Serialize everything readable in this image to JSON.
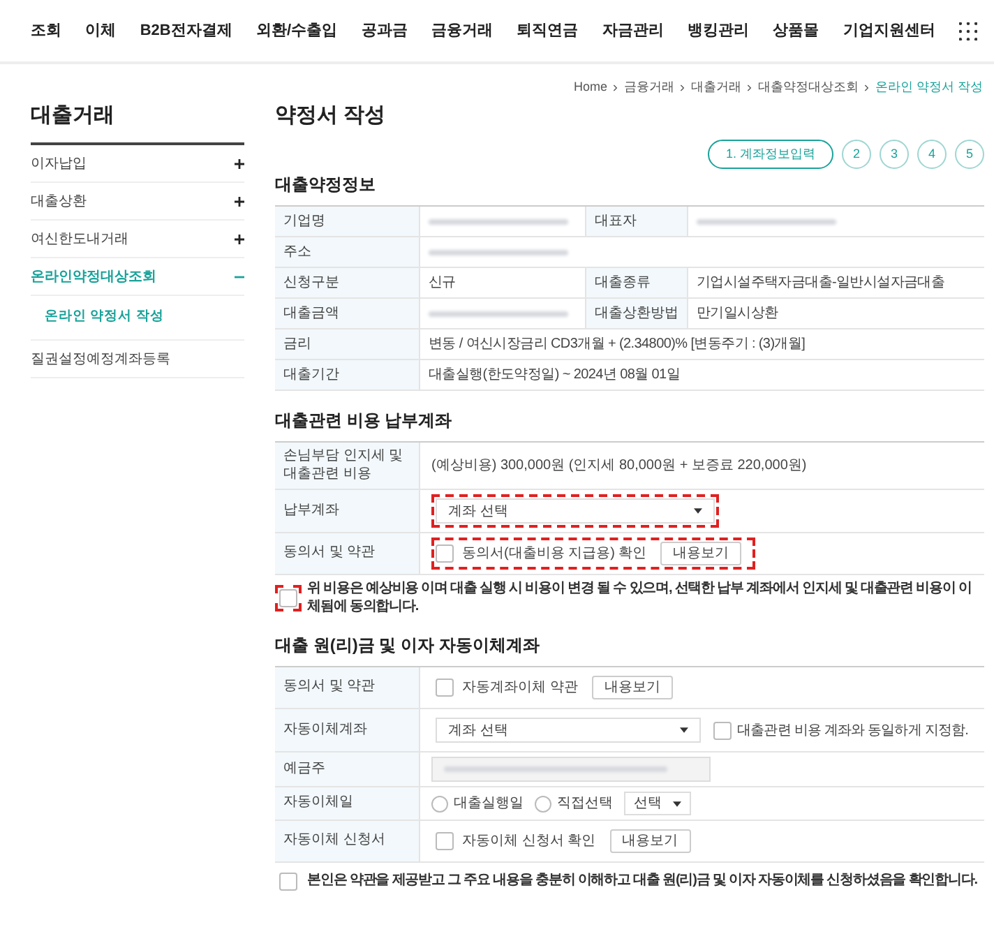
{
  "nav": {
    "items": [
      "조회",
      "이체",
      "B2B전자결제",
      "외환/수출입",
      "공과금",
      "금융거래",
      "퇴직연금",
      "자금관리",
      "뱅킹관리",
      "상품몰",
      "기업지원센터"
    ]
  },
  "breadcrumb": [
    {
      "label": "Home",
      "current": false
    },
    {
      "label": "금융거래",
      "current": false
    },
    {
      "label": "대출거래",
      "current": false
    },
    {
      "label": "대출약정대상조회",
      "current": false
    },
    {
      "label": "온라인 약정서 작성",
      "current": true
    }
  ],
  "sidebar": {
    "title": "대출거래",
    "items": [
      {
        "label": "이자납입",
        "expandable": true,
        "expanded": false,
        "selected": false
      },
      {
        "label": "대출상환",
        "expandable": true,
        "expanded": false,
        "selected": false
      },
      {
        "label": "여신한도내거래",
        "expandable": true,
        "expanded": false,
        "selected": false
      },
      {
        "label": "온라인약정대상조회",
        "expandable": true,
        "expanded": true,
        "selected": true,
        "children": [
          {
            "label": "온라인 약정서 작성",
            "selected": true
          }
        ]
      },
      {
        "label": "질권설정예정계좌등록",
        "selected": false
      }
    ]
  },
  "page_title": "약정서 작성",
  "steps": [
    {
      "label": "1. 계좌정보입력",
      "selected": true
    },
    {
      "label": "2",
      "selected": false
    },
    {
      "label": "3",
      "selected": false
    },
    {
      "label": "4",
      "selected": false
    },
    {
      "label": "5",
      "selected": false
    }
  ],
  "loan_info": {
    "title": "대출약정정보",
    "rows": [
      [
        {
          "label": "기업명",
          "kind": "redacted"
        },
        {
          "label": "대표자",
          "kind": "redacted"
        }
      ],
      [
        {
          "label": "주소",
          "kind": "redacted"
        }
      ],
      [
        {
          "label": "신청구분",
          "kind": "text",
          "value": "신규"
        },
        {
          "label": "대출종류",
          "kind": "text",
          "value": "기업시설주택자금대출-일반시설자금대출"
        }
      ],
      [
        {
          "label": "대출금액",
          "kind": "redacted"
        },
        {
          "label": "대출상환방법",
          "kind": "text",
          "value": "만기일시상환"
        }
      ],
      [
        {
          "label": "금리",
          "kind": "text",
          "value": "변동 / 여신시장금리 CD3개월 + (2.34800)% [변동주기 : (3)개월]"
        }
      ],
      [
        {
          "label": "대출기간",
          "kind": "text",
          "value": "대출실행(한도약정일) ~ 2024년 08월 01일"
        }
      ]
    ]
  },
  "fee_account": {
    "title": "대출관련 비용 납부계좌",
    "rows": [
      {
        "label": "손님부담 인지세 및 대출관련 비용",
        "kind": "text",
        "value": "(예상비용) 300,000원 (인지세 80,000원 + 보증료 220,000원)"
      },
      {
        "label": "납부계좌",
        "kind": "select",
        "value": "계좌 선택",
        "highlighted": true
      },
      {
        "label": "동의서 및 약관",
        "kind": "check_view",
        "value": "동의서(대출비용 지급용) 확인",
        "checked": false,
        "button": "내용보기",
        "highlighted": true
      }
    ],
    "agreement": {
      "text": "위 비용은 예상비용 이며 대출 실행 시 비용이 변경 될 수 있으며, 선택한 납부 계좌에서 인지세 및 대출관련 비용이 이체됨에 동의합니다.",
      "checked": false,
      "highlighted": true
    }
  },
  "auto_transfer": {
    "title": "대출 원(리)금 및 이자 자동이체계좌",
    "rows": [
      {
        "label": "동의서 및 약관",
        "kind": "check_view",
        "value": "자동계좌이체 약관",
        "checked": false,
        "button": "내용보기"
      },
      {
        "label": "자동이체계좌",
        "kind": "select_check",
        "value": "계좌 선택",
        "check_label": "대출관련 비용 계좌와 동일하게 지정함.",
        "checked": false
      },
      {
        "label": "예금주",
        "kind": "redacted_field"
      },
      {
        "label": "자동이체일",
        "kind": "radios",
        "options": [
          {
            "label": "대출실행일",
            "selected": false
          },
          {
            "label": "직접선택",
            "selected": false
          }
        ],
        "select": "선택"
      },
      {
        "label": "자동이체 신청서",
        "kind": "check_view",
        "value": "자동이체 신청서 확인",
        "checked": false,
        "button": "내용보기"
      }
    ],
    "agreement": {
      "text": "본인은 약관을 제공받고 그 주요 내용을 충분히 이해하고 대출 원(리)금 및 이자 자동이체를 신청하셨음을 확인합니다.",
      "checked": false
    }
  }
}
